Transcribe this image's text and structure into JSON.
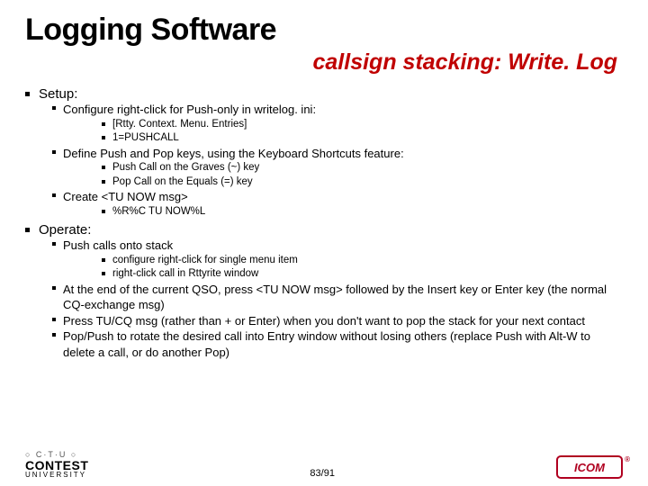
{
  "title": "Logging Software",
  "subtitle": "callsign stacking: Write. Log",
  "sections": [
    {
      "heading": "Setup:",
      "items": [
        {
          "text": "Configure right-click for Push-only in writelog. ini:",
          "sub": [
            {
              "text": "[Rtty. Context. Menu. Entries]"
            },
            {
              "text": "1=PUSHCALL"
            }
          ]
        },
        {
          "text": "Define Push and Pop keys, using the Keyboard Shortcuts feature:",
          "sub": [
            {
              "text": "Push Call on the Graves (~) key"
            },
            {
              "text": "Pop Call on the Equals (=) key"
            }
          ]
        },
        {
          "text": "Create <TU NOW msg>",
          "sub": [
            {
              "text": "%R%C TU NOW%L"
            }
          ]
        }
      ]
    },
    {
      "heading": "Operate:",
      "items": [
        {
          "text": "Push calls onto stack",
          "sub": [
            {
              "text": "configure right-click for single menu item"
            },
            {
              "text": "right-click call in Rttyrite window"
            }
          ]
        },
        {
          "text": "At the end of the current QSO, press <TU NOW msg> followed by the Insert key or Enter key (the normal CQ-exchange msg)"
        },
        {
          "text": "Press TU/CQ msg (rather than + or Enter) when you don't want to pop the stack for your next contact"
        },
        {
          "text": "Pop/Push to rotate the desired call into Entry window without losing others (replace Push with Alt-W to delete a call, or do another Pop)"
        }
      ]
    }
  ],
  "footer": {
    "logo_top": "○ C·T·U ○",
    "logo_main": "CONTEST",
    "logo_sub": "UNIVERSITY",
    "page": "83/91",
    "brand": "ICOM",
    "brand_reg": "®"
  }
}
